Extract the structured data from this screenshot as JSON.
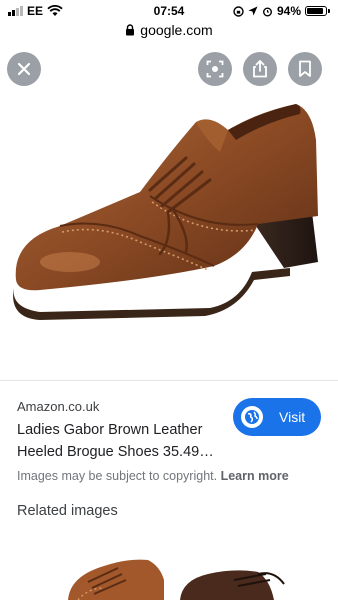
{
  "status": {
    "carrier": "EE",
    "time": "07:54",
    "battery": "94%",
    "battery_level": 0.94
  },
  "browser": {
    "url": "google.com"
  },
  "viewer": {
    "close_icon": "close-icon",
    "lens_icon": "lens-icon",
    "share_icon": "share-icon",
    "bookmark_icon": "bookmark-icon"
  },
  "result": {
    "source": "Amazon.co.uk",
    "title": "Ladies Gabor Brown Leather Heeled Brogue Shoes 35.49…",
    "visit_label": "Visit",
    "copyright_text": "Images may be subject to copyright.",
    "learn_more": "Learn more"
  },
  "related": {
    "title": "Related images"
  },
  "colors": {
    "accent": "#1a73e8",
    "shoe_leather": "#8b4a24"
  }
}
